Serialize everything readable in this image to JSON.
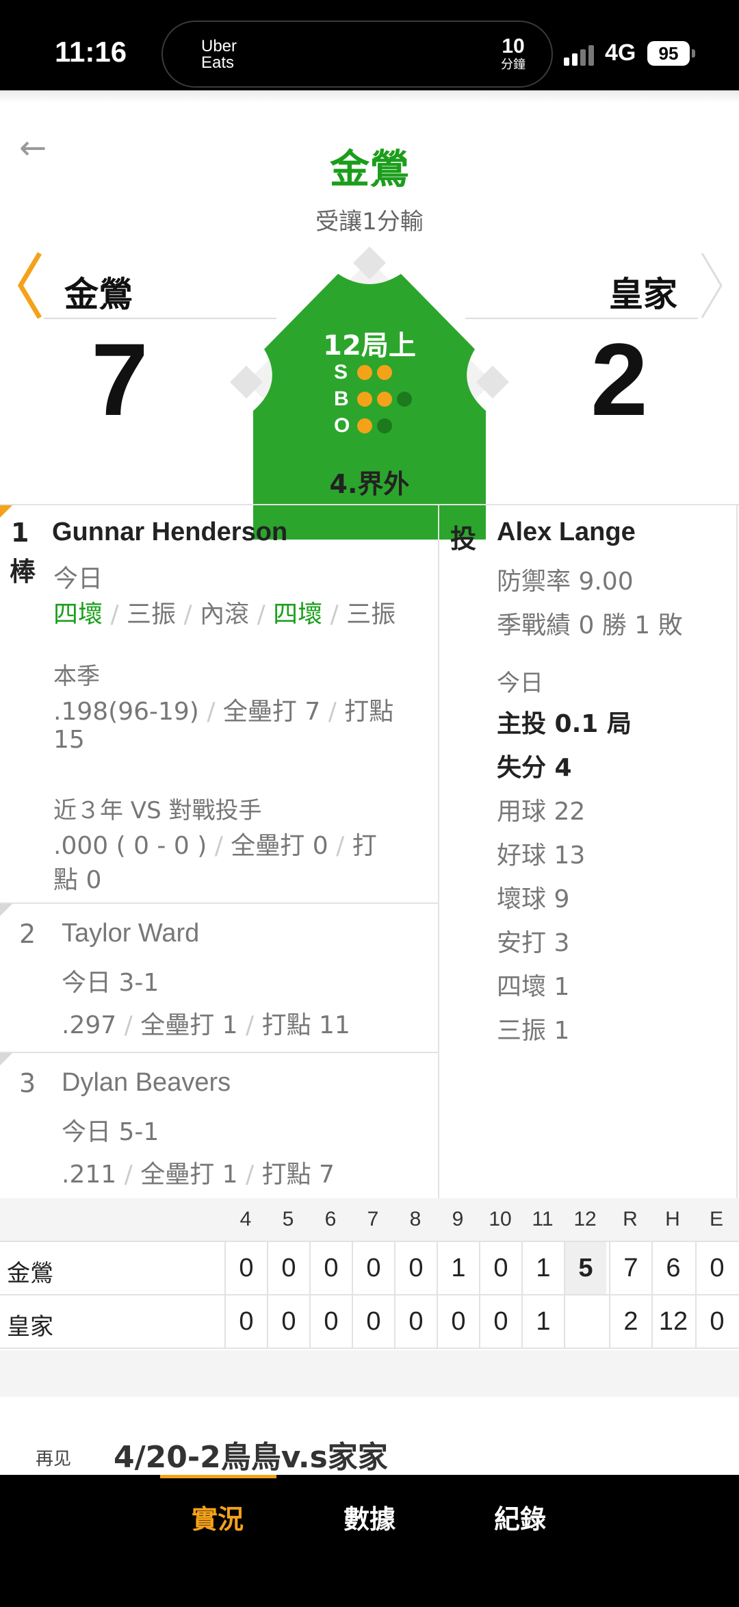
{
  "status_bar": {
    "time": "11:16",
    "island_app": "Uber Eats",
    "island_value": "10",
    "island_unit": "分鐘",
    "network": "4G",
    "battery": "95"
  },
  "header": {
    "leader_team": "金鶯",
    "leader_subtitle": "受讓1分輸"
  },
  "scoreboard": {
    "away_team": "金鶯",
    "home_team": "皇家",
    "away_score": "7",
    "home_score": "2",
    "inning": "12局上",
    "count": {
      "labels": [
        "S",
        "B",
        "O"
      ],
      "strikes": 2,
      "balls": 2,
      "outs": 1
    },
    "last_play": "4.界外"
  },
  "batters": [
    {
      "order": "1",
      "order_suffix": "棒",
      "name": "Gunnar Henderson",
      "today_label": "今日",
      "today_results": [
        "四壞",
        "三振",
        "內滾",
        "四壞",
        "三振"
      ],
      "season_label": "本季",
      "season_avg": ".198(96-19)",
      "season_hr": "全壘打 7",
      "season_rbi": "打點",
      "season_rbi_val": "15",
      "vs_label": "近３年 VS 對戰投手",
      "vs_avg": ".000 ( 0 - 0 )",
      "vs_hr": "全壘打 0",
      "vs_rbi": "打",
      "vs_rbi_val": "點 0"
    },
    {
      "order": "2",
      "name": "Taylor Ward",
      "today": "今日 3-1",
      "avg": ".297",
      "hr": "全壘打 1",
      "rbi": "打點 11"
    },
    {
      "order": "3",
      "name": "Dylan Beavers",
      "today": "今日 5-1",
      "avg": ".211",
      "hr": "全壘打 1",
      "rbi": "打點 7"
    }
  ],
  "pitcher": {
    "label": "投",
    "name": "Alex Lange",
    "era": "防禦率 9.00",
    "record": "季戰績 0 勝 1 敗",
    "today_label": "今日",
    "ip": "主投 0.1 局",
    "runs": "失分 4",
    "pitches": "用球 22",
    "strikes": "好球 13",
    "balls": "壞球 9",
    "hits": "安打 3",
    "walks": "四壞 1",
    "strikeouts": "三振 1"
  },
  "linescore": {
    "headers": [
      "4",
      "5",
      "6",
      "7",
      "8",
      "9",
      "10",
      "11",
      "12",
      "R",
      "H",
      "E"
    ],
    "rows": [
      {
        "team": "金鶯",
        "cells": [
          "0",
          "0",
          "0",
          "0",
          "0",
          "1",
          "0",
          "1",
          "5",
          "7",
          "6",
          "0"
        ]
      },
      {
        "team": "皇家",
        "cells": [
          "0",
          "0",
          "0",
          "0",
          "0",
          "0",
          "0",
          "1",
          "",
          "2",
          "12",
          "0"
        ]
      }
    ]
  },
  "next_game": {
    "tag": "再见",
    "title": "4/20-2鳥鳥v.s家家"
  },
  "tabs": [
    "實況",
    "數據",
    "紀錄"
  ],
  "colors": {
    "accent": "#f4a21a",
    "leader_green": "#1b9e1b",
    "field_green": "#2ca52c"
  }
}
